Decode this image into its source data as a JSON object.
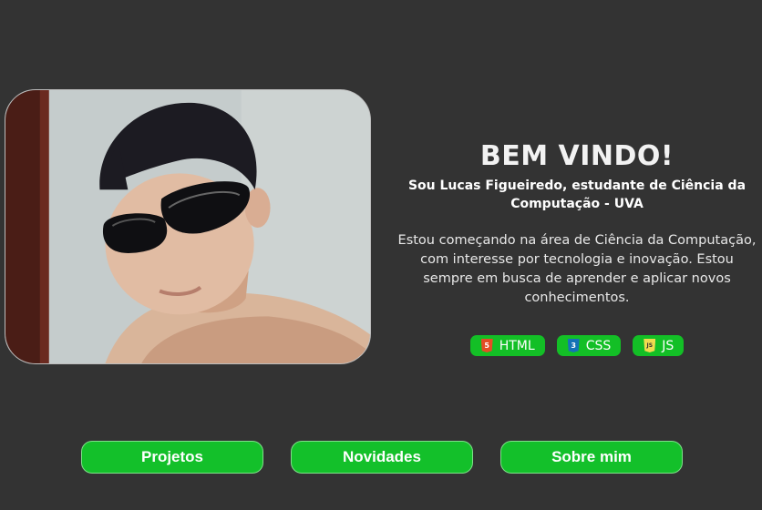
{
  "colors": {
    "background": "#333333",
    "accent_green": "#13c02a",
    "html_badge_icon": "#e44d26",
    "css_badge_icon": "#1572b6",
    "js_badge_icon": "#f0db4f"
  },
  "hero": {
    "title": "BEM VINDO!",
    "subtitle": "Sou Lucas Figueiredo, estudante de Ciência da Computação - UVA",
    "description": "Estou começando na área de Ciência da Computação, com interesse por tecnologia e inovação. Estou sempre em busca de aprender e aplicar novos conhecimentos."
  },
  "badges": [
    {
      "label": "HTML",
      "icon": "html5-icon",
      "glyph": "5"
    },
    {
      "label": "CSS",
      "icon": "css3-icon",
      "glyph": "3"
    },
    {
      "label": "JS",
      "icon": "javascript-icon",
      "glyph": "JS"
    }
  ],
  "nav": {
    "projects_label": "Projetos",
    "news_label": "Novidades",
    "about_label": "Sobre mim"
  }
}
